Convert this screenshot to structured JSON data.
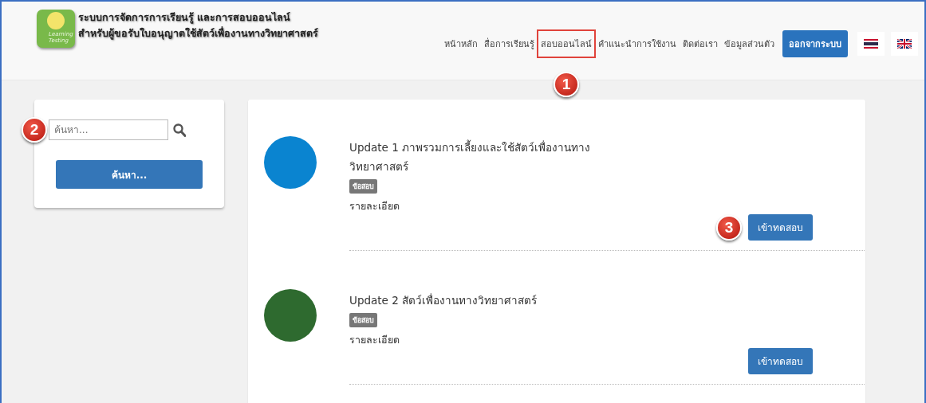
{
  "header": {
    "logo_text": [
      "Learning",
      "Testing"
    ],
    "title_lines": [
      "ระบบการจัดการการเรียนรู้ และการสอบออนไลน์",
      "สำหรับผู้ขอรับใบอนุญาตใช้สัตว์เพื่องานทางวิทยาศาสตร์"
    ]
  },
  "nav": [
    {
      "label": "หน้าหลัก",
      "highlighted": false
    },
    {
      "label": "สื่อการเรียนรู้",
      "highlighted": false
    },
    {
      "label": "สอบออนไลน์",
      "highlighted": true,
      "annotation": "1"
    },
    {
      "label": "คำแนะนำการใช้งาน",
      "highlighted": false
    },
    {
      "label": "ติดต่อเรา",
      "highlighted": false
    },
    {
      "label": "ข้อมูลส่วนตัว",
      "highlighted": false
    }
  ],
  "logout_button": "ออกจากระบบ",
  "languages": [
    {
      "kind": "thai"
    },
    {
      "kind": "uk"
    }
  ],
  "sidebar": {
    "annotation": "2",
    "search": {
      "placeholder": "ค้นหา..."
    },
    "search_button": "ค้นหา..."
  },
  "exams": [
    {
      "color": "#0a84d0",
      "title": "Update 1 ภาพรวมการเลี้ยงและใช้สัตว์เพื่องานทาง วิทยาศาสตร์",
      "tag": "ข้อสอบ",
      "details": "รายละเอียด",
      "button": "เข้าทดสอบ",
      "annotation": "3"
    },
    {
      "color": "#2e6a2f",
      "title": "Update 2 สัตว์เพื่องานทางวิทยาศาสตร์",
      "tag": "ข้อสอบ",
      "details": "รายละเอียด",
      "button": "เข้าทดสอบ"
    }
  ]
}
